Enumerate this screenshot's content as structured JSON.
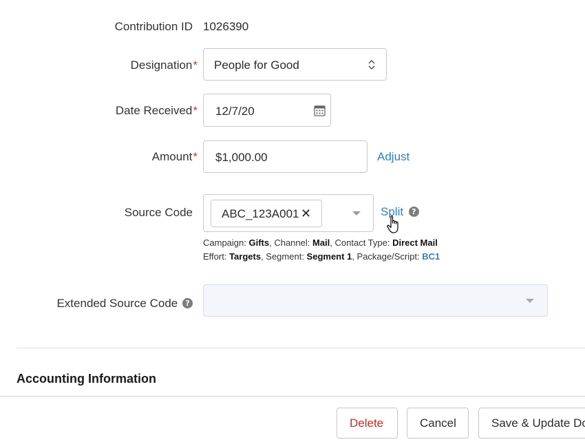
{
  "contribution": {
    "label": "Contribution ID",
    "value": "1026390"
  },
  "designation": {
    "label": "Designation",
    "required_mark": "*",
    "value": "People for Good",
    "icon": "updown-chevron-icon"
  },
  "date_received": {
    "label": "Date Received",
    "required_mark": "*",
    "value": "12/7/20",
    "icon": "calendar-icon"
  },
  "amount": {
    "label": "Amount",
    "required_mark": "*",
    "value": "$1,000.00",
    "action": "Adjust"
  },
  "source_code": {
    "label": "Source Code",
    "tag": "ABC_123A001",
    "remove_glyph": "✕",
    "action": "Split",
    "help_glyph": "?",
    "details": {
      "campaign_label": "Campaign: ",
      "campaign": "Gifts",
      "channel_label": ", Channel: ",
      "channel": "Mail",
      "contact_type_label": ", Contact Type: ",
      "contact_type": "Direct Mail",
      "effort_label": "Effort: ",
      "effort": "Targets",
      "segment_label": ", Segment: ",
      "segment": "Segment 1",
      "package_label": ", Package/Script: ",
      "package": "BC1"
    }
  },
  "extended_source_code": {
    "label": "Extended Source Code",
    "help_glyph": "?",
    "value": ""
  },
  "accounting": {
    "title": "Accounting Information"
  },
  "footer": {
    "delete": "Delete",
    "cancel": "Cancel",
    "save": "Save & Update Do"
  },
  "colors": {
    "accent": "#2f80c0",
    "required": "#c0392b",
    "danger": "#c62828",
    "disabled_bg": "#f3f6fa"
  }
}
